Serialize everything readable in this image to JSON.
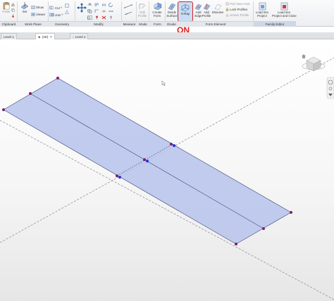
{
  "ribbon": {
    "paste_label": "Paste",
    "set_label": "Set",
    "show_label": "Show",
    "viewer_label": "Viewer",
    "cut_label": "Cut",
    "join_label": "Join",
    "edit_profile_label": "Edit\nProfile",
    "divide_surface_label": "Divide\nSurface",
    "create_form_label": "Create\nForm",
    "xray_label": "X-Ray",
    "add_edge_label": "Add\nEdge",
    "add_profile_label": "Add\nProfile",
    "dissolve_label": "Dissolve",
    "pick_new_host_label": "Pick New Host",
    "lock_profiles_label": "Lock Profiles",
    "unlock_profile_label": "Unlock Profile",
    "load_into_project_label": "Load into\nProject",
    "load_into_project_close_label": "Load into\nProject and Close",
    "panels": {
      "clipboard": "Clipboard",
      "work_plane": "Work Plane",
      "geometry": "Geometry",
      "modify": "Modify",
      "measure": "Measure",
      "mode": "Mode",
      "form": "Form",
      "divide": "Divide",
      "form_element": "Form Element",
      "family_editor": "Family Editor"
    }
  },
  "annotation": {
    "on_label": "ON"
  },
  "tabs": [
    {
      "label": "Level 1",
      "active": false
    },
    {
      "label": "{3D}",
      "active": true
    },
    {
      "label": "Level 1",
      "active": false
    }
  ],
  "colors": {
    "accent_red": "#e02020",
    "surface_fill": "#b7c3ec",
    "surface_stroke": "#4a5580",
    "vertex": "#7a1e6e",
    "selected_vertex": "#2036d8"
  }
}
